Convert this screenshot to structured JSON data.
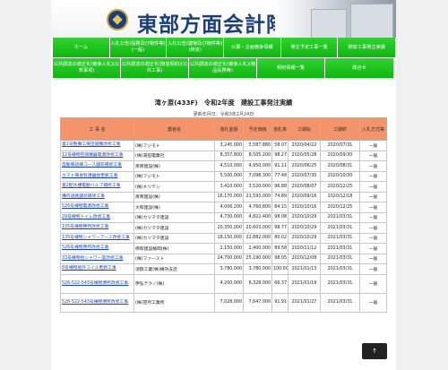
{
  "site": {
    "logo_text": "東部方面会計隊"
  },
  "nav": {
    "row1": [
      "ホーム",
      "入札公告(役務及び物件等)(一般)",
      "入札公告(建物及び物件等)(随意)",
      "公募・企画競争情報",
      "発注予定工事一覧",
      "随意工事発注実績"
    ],
    "row2": [
      "公共調達の適正化(競争入札)(公表事項)",
      "公共調達の適正化(随意契約)(公共工事)",
      "公共調達の適正化(競争入札)(物品役務等)",
      "契約情報一覧",
      "問合せ"
    ]
  },
  "page": {
    "title": "滝ヶ原(433F)　令和2年度　建設工事発注実績",
    "updated": "更新年月日：令和3年2月24日"
  },
  "table": {
    "headers": [
      "工 事 名",
      "業者名",
      "落札金額",
      "予定価格",
      "落札率",
      "工期始",
      "工期終",
      "入札方式等"
    ],
    "rows": [
      {
        "name": "第1号整備工場空調機改修工事",
        "contractor": "(株)フジモト",
        "amount": "3,245,000",
        "planned": "5,587,880",
        "rate": "58.07",
        "start": "2020/04/22",
        "end": "2020/07/31",
        "method": "一般"
      },
      {
        "name": "12号棟物空調機器電源改修工事",
        "contractor": "(株)湯田電業社",
        "amount": "8,357,800",
        "planned": "8,505,200",
        "rate": "98.27",
        "start": "2020/05/28",
        "end": "2020/09/30",
        "method": "一般"
      },
      {
        "name": "自動車訓練コース舗装補修工事",
        "contractor": "斎商建設(株)",
        "amount": "4,510,000",
        "planned": "4,950,000",
        "rate": "91.11",
        "start": "2020/06/25",
        "end": "2020/08/31",
        "method": "一般"
      },
      {
        "name": "カマド場食料漕器他更新工事",
        "contractor": "(株)フジモト",
        "amount": "5,500,000",
        "planned": "7,098,300",
        "rate": "77.48",
        "start": "2020/07/30",
        "end": "2020/10/30",
        "method": "一般"
      },
      {
        "name": "第2配水槽電動バルブ補修工事",
        "contractor": "(株)ネツテン",
        "amount": "3,410,000",
        "planned": "3,520,000",
        "rate": "96.88",
        "start": "2020/08/07",
        "end": "2020/12/25",
        "method": "一般"
      },
      {
        "name": "構内道路舗装補修工事",
        "contractor": "斎商建設(株)",
        "amount": "16,170,000",
        "planned": "21,593,000",
        "rate": "74.89",
        "start": "2020/09/16",
        "end": "2020/12/18",
        "method": "一般"
      },
      {
        "name": "526号棟物電源改修工事",
        "contractor": "大和建設(株)",
        "amount": "4,006,200",
        "planned": "4,760,800",
        "rate": "84.15",
        "start": "2020/10/16",
        "end": "2020/12/25",
        "method": "一般"
      },
      {
        "name": "29号棟物トイレ改修工事",
        "contractor": "(株)カツマタ建設",
        "amount": "4,730,000",
        "planned": "4,822,400",
        "rate": "98.08",
        "start": "2020/10/29",
        "end": "2021/03/31",
        "method": "一般"
      },
      {
        "name": "135号棟物便所改修工事",
        "contractor": "(株)カツマタ建設",
        "amount": "20,350,000",
        "planned": "20,603,000",
        "rate": "98.77",
        "start": "2020/10/29",
        "end": "2021/03/31",
        "method": "一般"
      },
      {
        "name": "135号棟物シャワーブース改修工事",
        "contractor": "(株)カツマタ建設",
        "amount": "18,150,000",
        "planned": "22,882,000",
        "rate": "80.02",
        "start": "2020/10/29",
        "end": "2021/03/31",
        "method": "一般"
      },
      {
        "name": "526号棟物便所改修工事",
        "contractor": "佛和建設静岡(株)",
        "amount": "2,150,000",
        "planned": "2,400,000",
        "rate": "89.58",
        "start": "2020/11/12",
        "end": "2021/03/31",
        "method": "一般"
      },
      {
        "name": "33号棟物他シャワー室改修工事",
        "contractor": "(株)ファースト",
        "amount": "24,700,000",
        "planned": "25,190,000",
        "rate": "98.05",
        "start": "2020/12/08",
        "end": "2021/03/31",
        "method": "一般"
      },
      {
        "name": "8号棟物屋外コイル更新工事",
        "contractor": "須賀工業(株)横浜支店",
        "amount": "3,780,000",
        "planned": "3,780,000",
        "rate": "100.00",
        "start": "2021/01/13",
        "end": "2021/03/31",
        "method": "一般"
      },
      {
        "name": "526-522-543号棟物便所改修工事",
        "contractor": "伊弘テクノ(株)",
        "amount": "4,200,000",
        "planned": "6,328,000",
        "rate": "66.37",
        "start": "2021/01/19",
        "end": "2021/03/31",
        "method": "一般"
      },
      {
        "name": "526-522-543号棟物便所改修工事",
        "contractor": "(株)望月工業所",
        "amount": "7,028,000",
        "planned": "7,647,000",
        "rate": "91.91",
        "start": "2021/01/27",
        "end": "2021/03/31",
        "method": "一般"
      }
    ]
  },
  "top_button": {
    "label": "↑"
  },
  "colors": {
    "nav_green": "#11b511",
    "header_orange": "#f4946b",
    "logo_blue": "#1a3f7a",
    "link_blue": "#1a44c8"
  }
}
